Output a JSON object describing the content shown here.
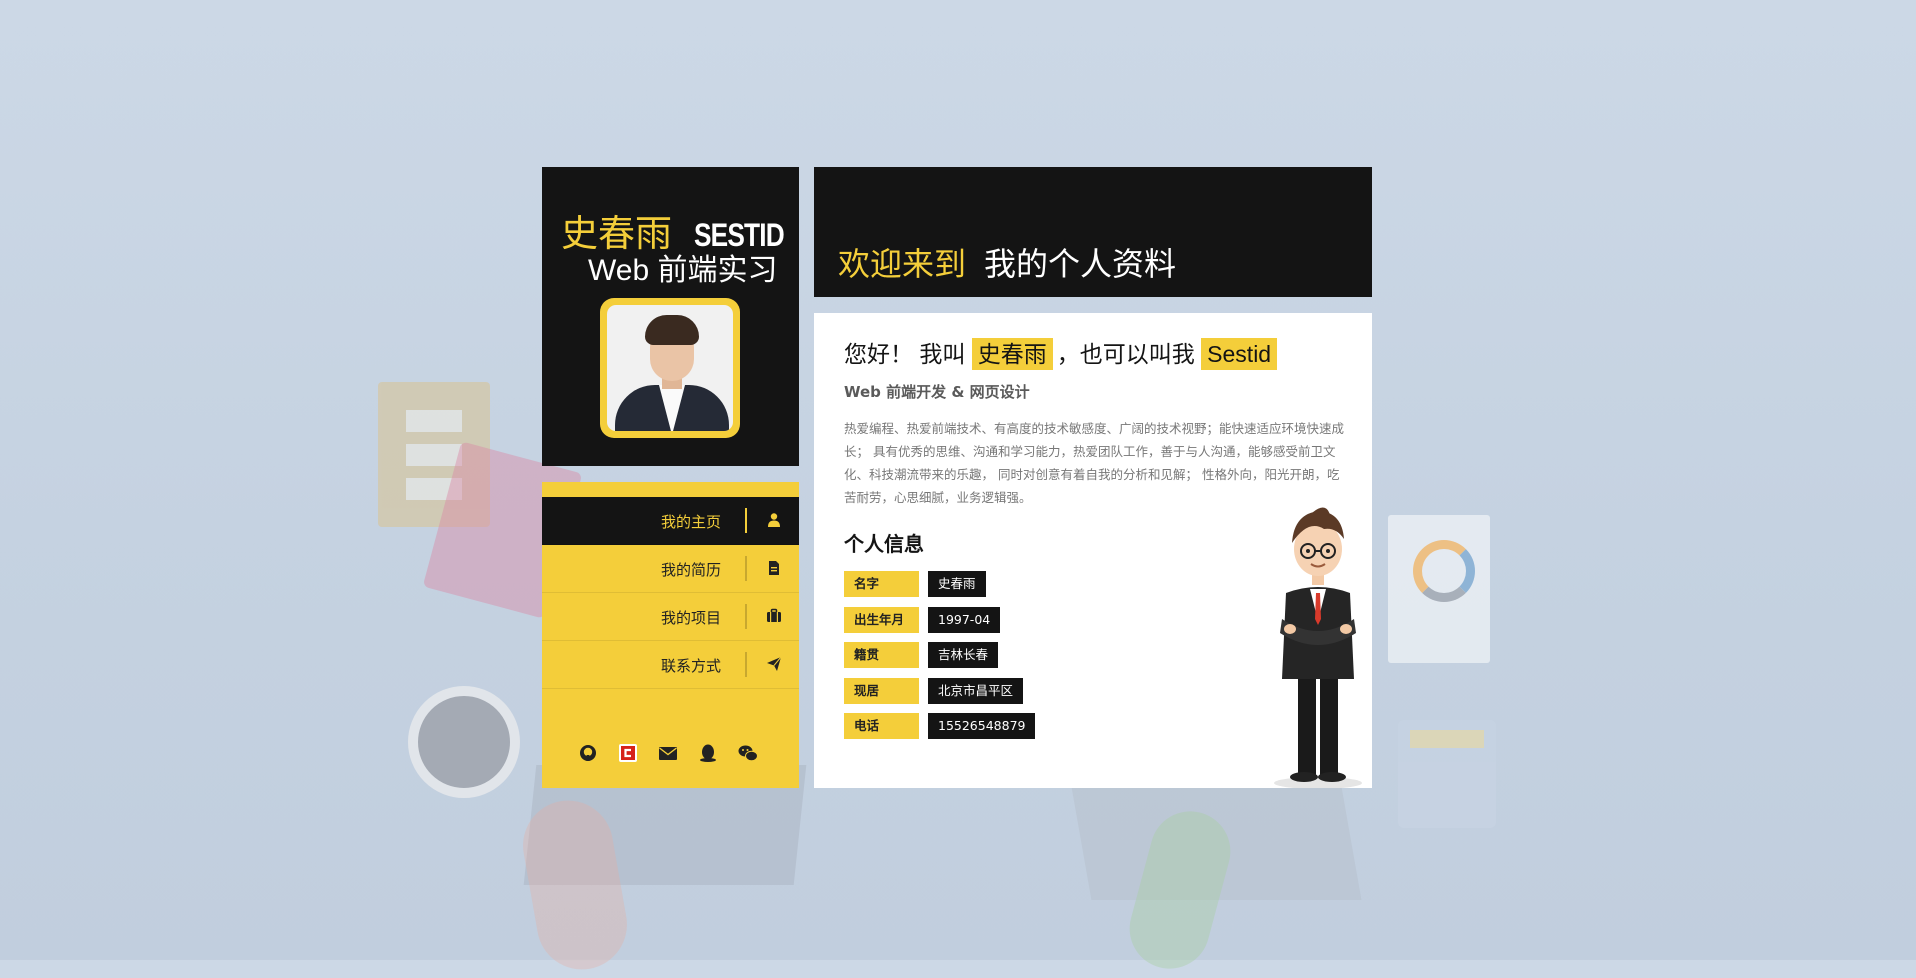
{
  "profile": {
    "name_cn": "史春雨",
    "name_en": "SESTID",
    "role": "Web 前端实习"
  },
  "nav": {
    "items": [
      {
        "label": "我的主页",
        "icon": "user-icon",
        "active": true
      },
      {
        "label": "我的简历",
        "icon": "document-icon",
        "active": false
      },
      {
        "label": "我的项目",
        "icon": "briefcase-icon",
        "active": false
      },
      {
        "label": "联系方式",
        "icon": "paper-plane-icon",
        "active": false
      }
    ]
  },
  "social": [
    "github-icon",
    "csdn-icon",
    "email-icon",
    "qq-icon",
    "wechat-icon"
  ],
  "welcome": {
    "prefix": "欢迎来到",
    "title": "我的个人资料"
  },
  "intro": {
    "greeting_1": "您好！ 我叫",
    "name": "史春雨",
    "greeting_2": "，也可以叫我",
    "nickname": "Sestid",
    "subtitle": "Web 前端开发 & 网页设计",
    "bio": "热爱编程、热爱前端技术、有高度的技术敏感度、广阔的技术视野；能快速适应环境快速成长； 具有优秀的思维、沟通和学习能力，热爱团队工作，善于与人沟通，能够感受前卫文化、科技潮流带来的乐趣， 同时对创意有着自我的分析和见解； 性格外向，阳光开朗，吃苦耐劳，心思细腻，业务逻辑强。"
  },
  "info": {
    "title": "个人信息",
    "rows": [
      {
        "key": "名字",
        "value": "史春雨"
      },
      {
        "key": "出生年月",
        "value": "1997-04"
      },
      {
        "key": "籍贯",
        "value": "吉林长春"
      },
      {
        "key": "现居",
        "value": "北京市昌平区"
      },
      {
        "key": "电话",
        "value": "15526548879"
      }
    ]
  },
  "colors": {
    "accent": "#f4ce3a",
    "dark": "#141414",
    "background": "#c9d5e4"
  }
}
